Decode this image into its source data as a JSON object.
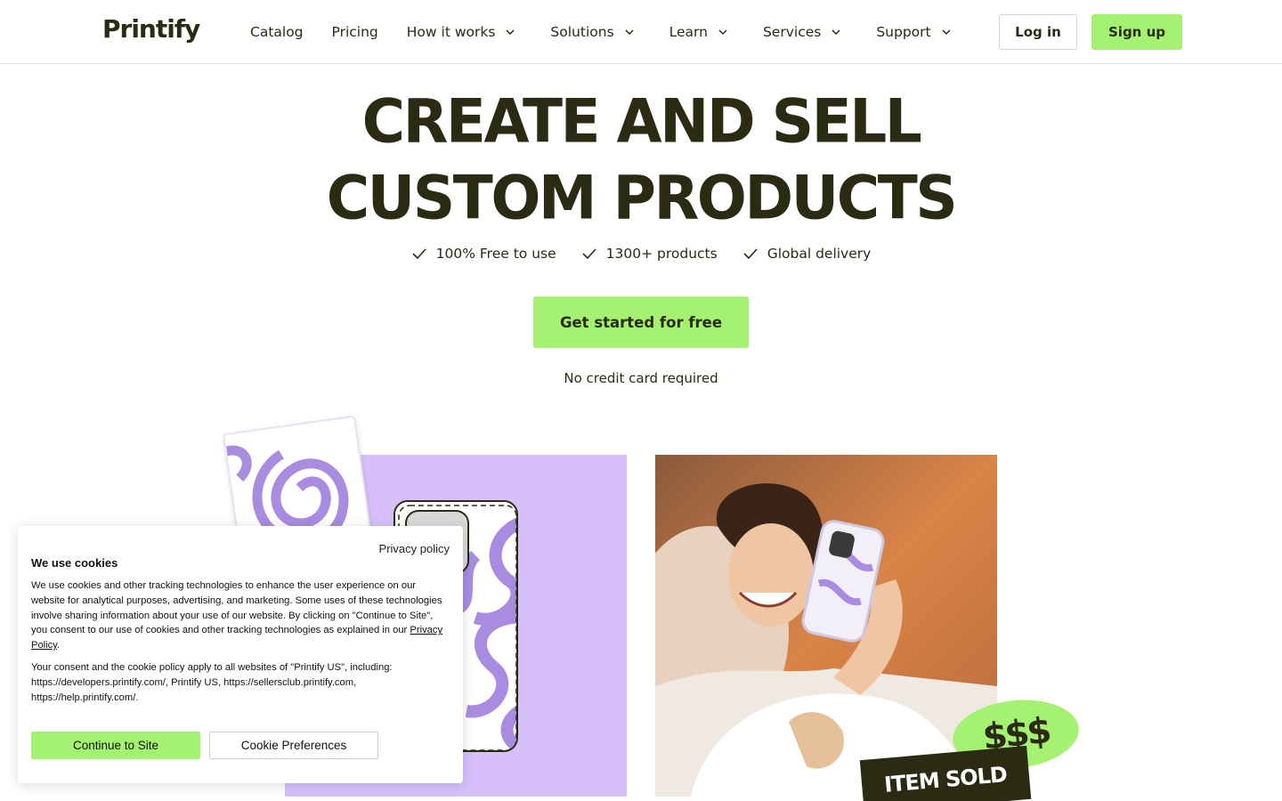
{
  "brand": {
    "name": "Printify",
    "accent": "#a5f171",
    "dark": "#2b2a12",
    "lavender": "#d7c0fa"
  },
  "nav": {
    "items": [
      {
        "label": "Catalog",
        "dropdown": false
      },
      {
        "label": "Pricing",
        "dropdown": false
      },
      {
        "label": "How it works",
        "dropdown": true
      },
      {
        "label": "Solutions",
        "dropdown": true
      },
      {
        "label": "Learn",
        "dropdown": true
      },
      {
        "label": "Services",
        "dropdown": true
      },
      {
        "label": "Support",
        "dropdown": true
      }
    ],
    "login": "Log in",
    "signup": "Sign up"
  },
  "hero": {
    "title_line1": "CREATE AND SELL",
    "title_line2": "CUSTOM PRODUCTS",
    "features": [
      "100% Free to use",
      "1300+ products",
      "Global delivery"
    ],
    "cta": "Get started for free",
    "note": "No credit card required"
  },
  "stickers": {
    "money": "$$$",
    "sold": "ITEM SOLD"
  },
  "cookie": {
    "privacy_link": "Privacy policy",
    "title": "We use cookies",
    "p1_text": "We use cookies and other tracking technologies to enhance the user experience on our website for analytical purposes, advertising, and marketing. Some uses of these technologies involve sharing information about your use of our website. By clicking on \"Continue to Site\", you consent to our use of cookies and other tracking technologies as explained in our ",
    "p1_link": "Privacy Policy",
    "p1_end": ".",
    "p2": "Your consent and the cookie policy apply to all websites of \"Printify US\", including: https://developers.printify.com/, Printify US, https://sellersclub.printify.com, https://help.printify.com/.",
    "continue": "Continue to Site",
    "preferences": "Cookie Preferences"
  }
}
